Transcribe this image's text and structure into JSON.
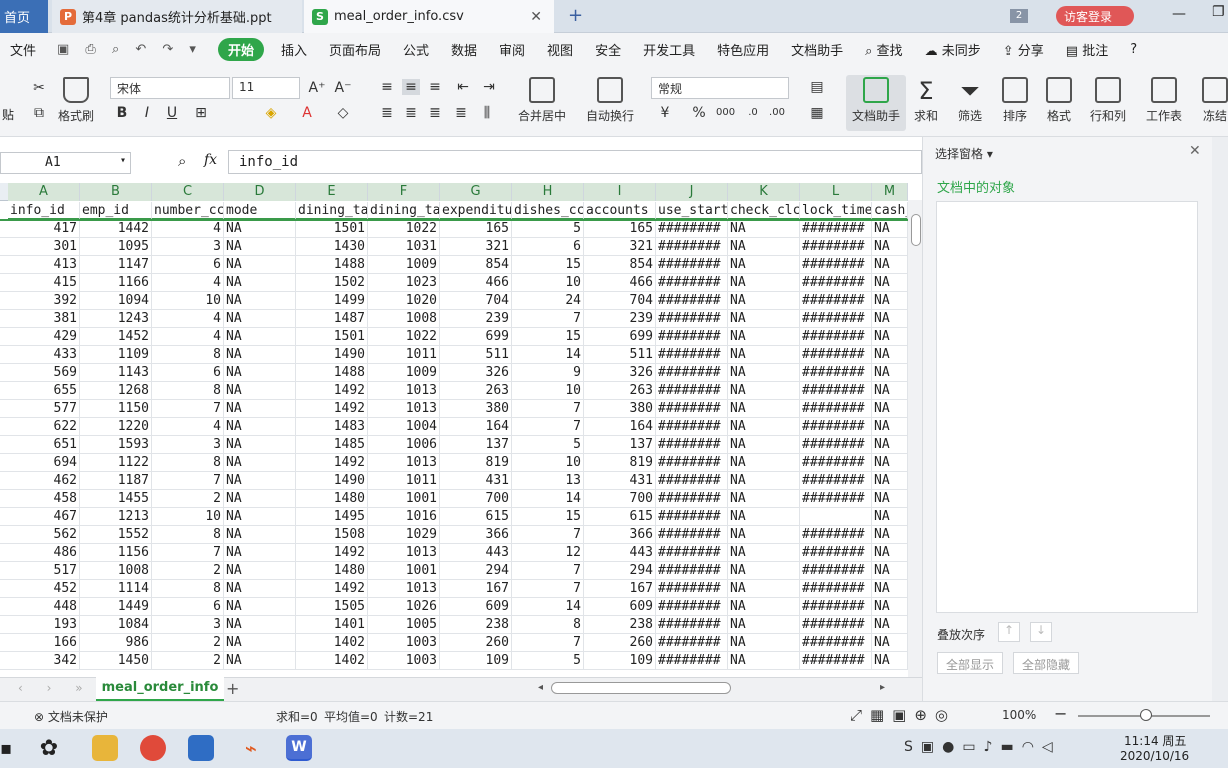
{
  "tabs": [
    {
      "label": "首页"
    },
    {
      "label": "第4章 pandas统计分析基础.ppt"
    },
    {
      "label": "meal_order_info.csv"
    }
  ],
  "tabbar": {
    "badge": "2",
    "login": "访客登录"
  },
  "menu": [
    "文件",
    "开始",
    "插入",
    "页面布局",
    "公式",
    "数据",
    "审阅",
    "视图",
    "安全",
    "开发工具",
    "特色应用",
    "文档助手",
    "查找",
    "未同步",
    "分享",
    "批注",
    "?"
  ],
  "ribbon": {
    "paste": "贴",
    "format_painter": "格式刷",
    "font_name": "宋体",
    "font_size": "11",
    "merge_center": "合并居中",
    "auto_wrap": "自动换行",
    "number_format": "常规",
    "doc_assistant": "文档助手",
    "sum": "求和",
    "filter": "筛选",
    "sort": "排序",
    "format": "格式",
    "row_col": "行和列",
    "worksheet": "工作表",
    "freeze": "冻结"
  },
  "formula_bar": {
    "cell_ref": "A1",
    "fx": "fx",
    "content": "info_id"
  },
  "columns": [
    "A",
    "B",
    "C",
    "D",
    "E",
    "F",
    "G",
    "H",
    "I",
    "J",
    "K",
    "L",
    "M"
  ],
  "header_row": [
    "info_id",
    "emp_id",
    "number_cc",
    "mode",
    "dining_ta",
    "dining_ta",
    "expenditu",
    "dishes_cc",
    "accounts",
    "use_start",
    "check_clc",
    "lock_time",
    "cash_"
  ],
  "rows": [
    [
      "417",
      "1442",
      "4",
      "NA",
      "1501",
      "1022",
      "165",
      "5",
      "165",
      "########",
      "NA",
      "########",
      "NA"
    ],
    [
      "301",
      "1095",
      "3",
      "NA",
      "1430",
      "1031",
      "321",
      "6",
      "321",
      "########",
      "NA",
      "########",
      "NA"
    ],
    [
      "413",
      "1147",
      "6",
      "NA",
      "1488",
      "1009",
      "854",
      "15",
      "854",
      "########",
      "NA",
      "########",
      "NA"
    ],
    [
      "415",
      "1166",
      "4",
      "NA",
      "1502",
      "1023",
      "466",
      "10",
      "466",
      "########",
      "NA",
      "########",
      "NA"
    ],
    [
      "392",
      "1094",
      "10",
      "NA",
      "1499",
      "1020",
      "704",
      "24",
      "704",
      "########",
      "NA",
      "########",
      "NA"
    ],
    [
      "381",
      "1243",
      "4",
      "NA",
      "1487",
      "1008",
      "239",
      "7",
      "239",
      "########",
      "NA",
      "########",
      "NA"
    ],
    [
      "429",
      "1452",
      "4",
      "NA",
      "1501",
      "1022",
      "699",
      "15",
      "699",
      "########",
      "NA",
      "########",
      "NA"
    ],
    [
      "433",
      "1109",
      "8",
      "NA",
      "1490",
      "1011",
      "511",
      "14",
      "511",
      "########",
      "NA",
      "########",
      "NA"
    ],
    [
      "569",
      "1143",
      "6",
      "NA",
      "1488",
      "1009",
      "326",
      "9",
      "326",
      "########",
      "NA",
      "########",
      "NA"
    ],
    [
      "655",
      "1268",
      "8",
      "NA",
      "1492",
      "1013",
      "263",
      "10",
      "263",
      "########",
      "NA",
      "########",
      "NA"
    ],
    [
      "577",
      "1150",
      "7",
      "NA",
      "1492",
      "1013",
      "380",
      "7",
      "380",
      "########",
      "NA",
      "########",
      "NA"
    ],
    [
      "622",
      "1220",
      "4",
      "NA",
      "1483",
      "1004",
      "164",
      "7",
      "164",
      "########",
      "NA",
      "########",
      "NA"
    ],
    [
      "651",
      "1593",
      "3",
      "NA",
      "1485",
      "1006",
      "137",
      "5",
      "137",
      "########",
      "NA",
      "########",
      "NA"
    ],
    [
      "694",
      "1122",
      "8",
      "NA",
      "1492",
      "1013",
      "819",
      "10",
      "819",
      "########",
      "NA",
      "########",
      "NA"
    ],
    [
      "462",
      "1187",
      "7",
      "NA",
      "1490",
      "1011",
      "431",
      "13",
      "431",
      "########",
      "NA",
      "########",
      "NA"
    ],
    [
      "458",
      "1455",
      "2",
      "NA",
      "1480",
      "1001",
      "700",
      "14",
      "700",
      "########",
      "NA",
      "########",
      "NA"
    ],
    [
      "467",
      "1213",
      "10",
      "NA",
      "1495",
      "1016",
      "615",
      "15",
      "615",
      "########",
      "NA",
      "",
      "NA"
    ],
    [
      "562",
      "1552",
      "8",
      "NA",
      "1508",
      "1029",
      "366",
      "7",
      "366",
      "########",
      "NA",
      "########",
      "NA"
    ],
    [
      "486",
      "1156",
      "7",
      "NA",
      "1492",
      "1013",
      "443",
      "12",
      "443",
      "########",
      "NA",
      "########",
      "NA"
    ],
    [
      "517",
      "1008",
      "2",
      "NA",
      "1480",
      "1001",
      "294",
      "7",
      "294",
      "########",
      "NA",
      "########",
      "NA"
    ],
    [
      "452",
      "1114",
      "8",
      "NA",
      "1492",
      "1013",
      "167",
      "7",
      "167",
      "########",
      "NA",
      "########",
      "NA"
    ],
    [
      "448",
      "1449",
      "6",
      "NA",
      "1505",
      "1026",
      "609",
      "14",
      "609",
      "########",
      "NA",
      "########",
      "NA"
    ],
    [
      "193",
      "1084",
      "3",
      "NA",
      "1401",
      "1005",
      "238",
      "8",
      "238",
      "########",
      "NA",
      "########",
      "NA"
    ],
    [
      "166",
      "986",
      "2",
      "NA",
      "1402",
      "1003",
      "260",
      "7",
      "260",
      "########",
      "NA",
      "########",
      "NA"
    ],
    [
      "342",
      "1450",
      "2",
      "NA",
      "1402",
      "1003",
      "109",
      "5",
      "109",
      "########",
      "NA",
      "########",
      "NA"
    ]
  ],
  "sheet_tab": "meal_order_info",
  "pane": {
    "title": "选择窗格",
    "subtitle": "文档中的对象",
    "order_label": "叠放次序",
    "show_all": "全部显示",
    "hide_all": "全部隐藏"
  },
  "status": {
    "protect": "文档未保护",
    "sum": "求和=0",
    "avg": "平均值=0",
    "count": "计数=21",
    "zoom": "100%"
  },
  "clock": {
    "time": "11:14 周五",
    "date": "2020/10/16"
  }
}
